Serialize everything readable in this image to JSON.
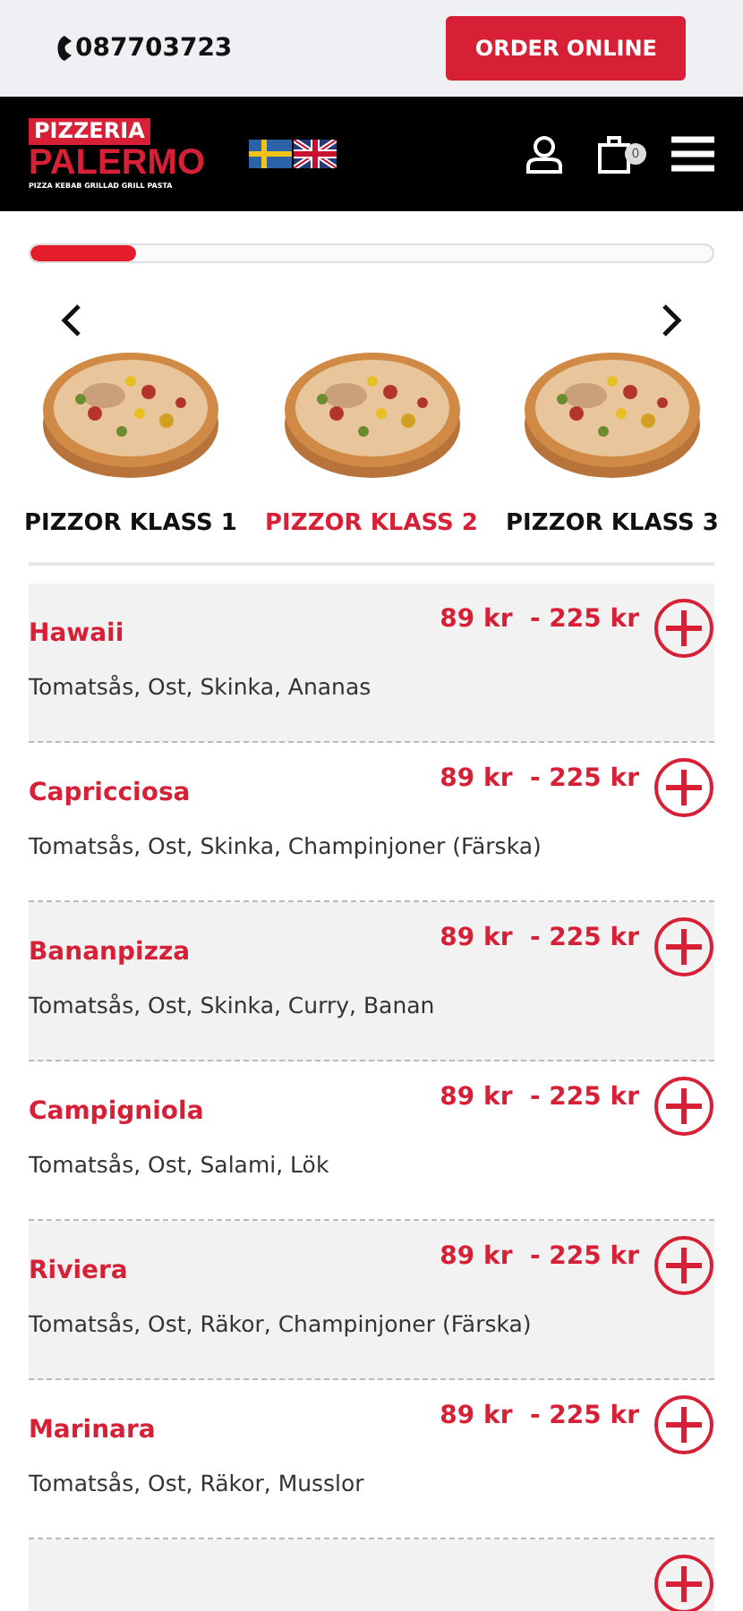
{
  "topbar": {
    "phone": "087703723",
    "order_button": "ORDER ONLINE"
  },
  "header": {
    "logo": {
      "line1": "PIZZERIA",
      "line2": "PALERMO",
      "tagline": "PIZZA KEBAB GRILLAD GRILL PASTA"
    },
    "cart_count": "0"
  },
  "carousel": {
    "level": 0.155,
    "categories": [
      {
        "label": "PIZZOR KLASS 1",
        "selected": false
      },
      {
        "label": "PIZZOR KLASS 2",
        "selected": true
      },
      {
        "label": "PIZZOR KLASS 3",
        "selected": false
      }
    ]
  },
  "menu": [
    {
      "name": "Hawaii",
      "price": "89 kr  - 225 kr",
      "ingredients": "Tomatsås, Ost, Skinka, Ananas"
    },
    {
      "name": "Capricciosa",
      "price": "89 kr  - 225 kr",
      "ingredients": "Tomatsås, Ost, Skinka, Champinjoner (Färska)"
    },
    {
      "name": "Bananpizza",
      "price": "89 kr  - 225 kr",
      "ingredients": "Tomatsås, Ost, Skinka, Curry, Banan"
    },
    {
      "name": "Campigniola",
      "price": "89 kr  - 225 kr",
      "ingredients": "Tomatsås, Ost, Salami, Lök"
    },
    {
      "name": "Riviera",
      "price": "89 kr  - 225 kr",
      "ingredients": "Tomatsås, Ost, Räkor, Champinjoner (Färska)"
    },
    {
      "name": "Marinara",
      "price": "89 kr  - 225 kr",
      "ingredients": "Tomatsås, Ost, Räkor, Musslor"
    }
  ]
}
